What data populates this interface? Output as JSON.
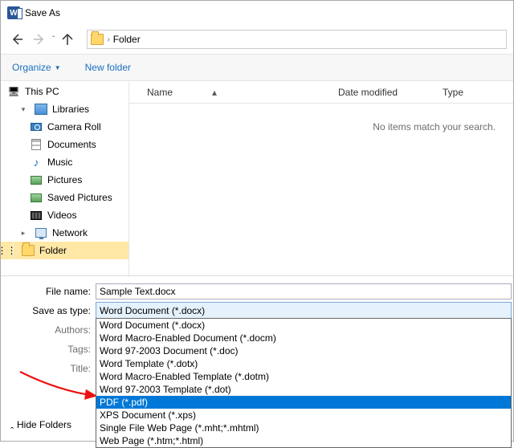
{
  "window": {
    "title": "Save As"
  },
  "breadcrumb": {
    "folder": "Folder"
  },
  "toolbar": {
    "organize": "Organize",
    "newfolder": "New folder"
  },
  "tree": {
    "thispc": "This PC",
    "libraries": "Libraries",
    "cameraroll": "Camera Roll",
    "documents": "Documents",
    "music": "Music",
    "pictures": "Pictures",
    "savedpictures": "Saved Pictures",
    "videos": "Videos",
    "network": "Network",
    "folder": "Folder"
  },
  "columns": {
    "name": "Name",
    "date": "Date modified",
    "type": "Type"
  },
  "empty": "No items match your search.",
  "form": {
    "filename_label": "File name:",
    "filename_value": "Sample Text.docx",
    "saveastype_label": "Save as type:",
    "saveastype_value": "Word Document (*.docx)",
    "authors_label": "Authors:",
    "tags_label": "Tags:",
    "title_label": "Title:"
  },
  "dropdown": {
    "options": [
      "Word Document (*.docx)",
      "Word Macro-Enabled Document (*.docm)",
      "Word 97-2003 Document (*.doc)",
      "Word Template (*.dotx)",
      "Word Macro-Enabled Template (*.dotm)",
      "Word 97-2003 Template (*.dot)",
      "PDF (*.pdf)",
      "XPS Document (*.xps)",
      "Single File Web Page (*.mht;*.mhtml)",
      "Web Page (*.htm;*.html)"
    ],
    "highlight_index": 6
  },
  "footer": {
    "hide_folders": "Hide Folders"
  }
}
